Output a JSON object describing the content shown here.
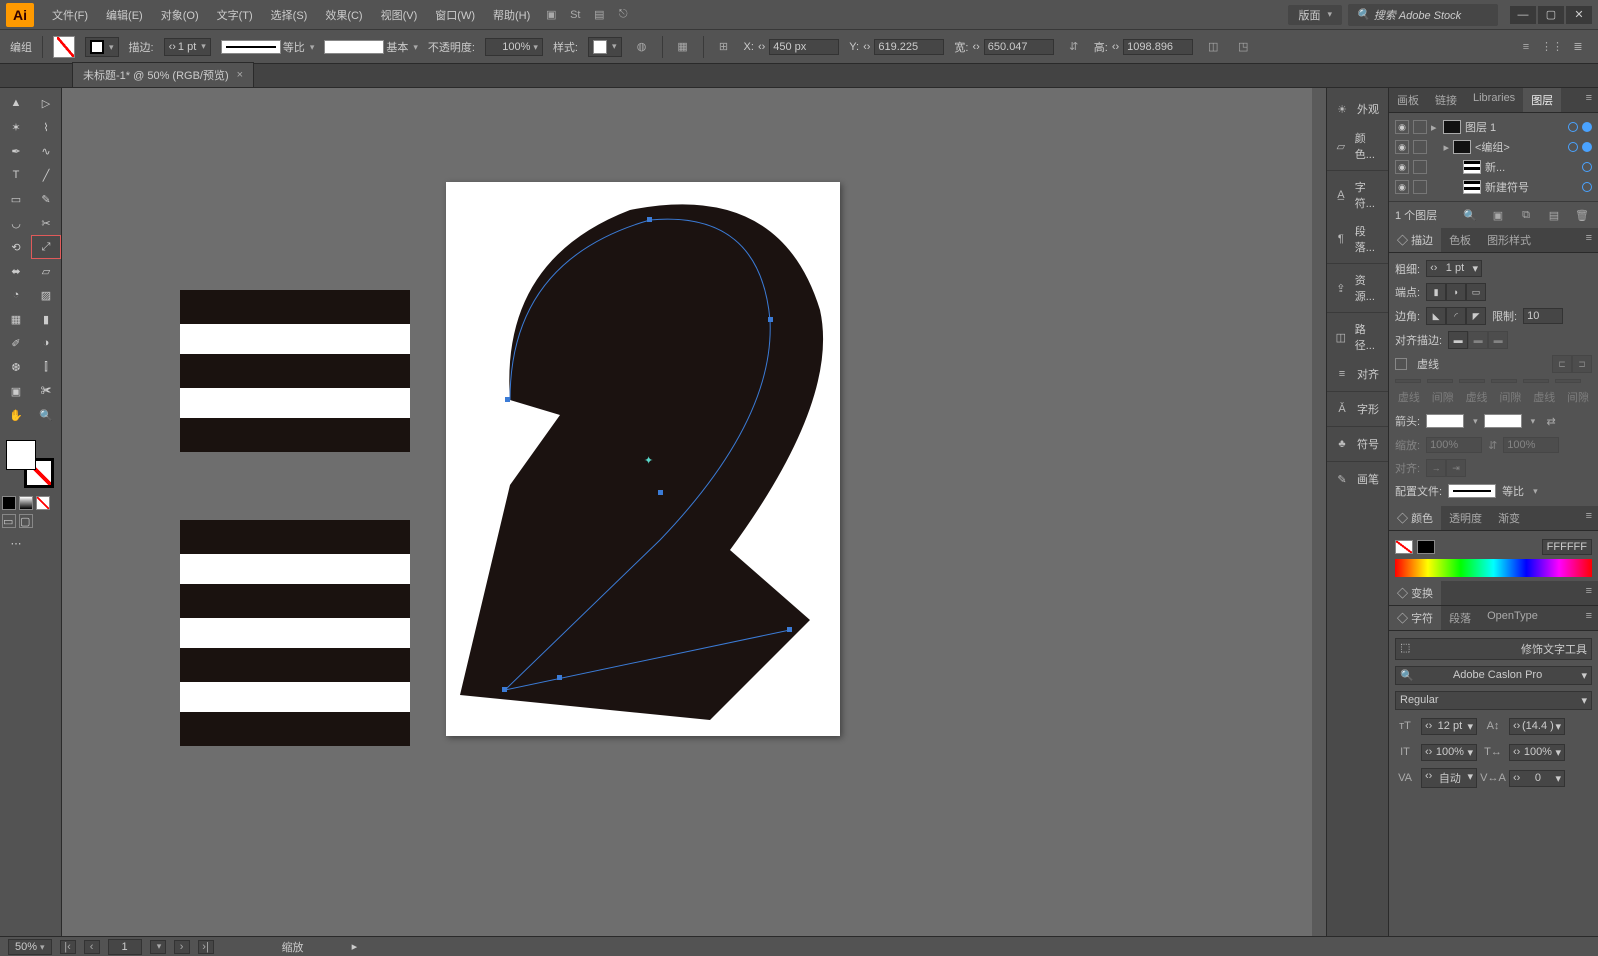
{
  "menu": {
    "items": [
      "文件(F)",
      "编辑(E)",
      "对象(O)",
      "文字(T)",
      "选择(S)",
      "效果(C)",
      "视图(V)",
      "窗口(W)",
      "帮助(H)"
    ],
    "layout_label": "版面",
    "search_placeholder": "搜索 Adobe Stock"
  },
  "control": {
    "mode_label": "编组",
    "stroke_label": "描边:",
    "stroke_weight": "1 pt",
    "profile_label": "等比",
    "brush_label": "基本",
    "opacity_label": "不透明度:",
    "opacity_value": "100%",
    "style_label": "样式:",
    "x_label": "X:",
    "x_value": "450 px",
    "y_label": "Y:",
    "y_value": "619.225",
    "w_label": "宽:",
    "w_value": "650.047",
    "h_label": "高:",
    "h_value": "1098.896"
  },
  "doc_tab": {
    "title": "未标题-1* @ 50% (RGB/预览)"
  },
  "dock": {
    "items": [
      "外观",
      "颜色...",
      "字符...",
      "段落...",
      "资源...",
      "路径...",
      "对齐",
      "字形",
      "符号",
      "画笔"
    ]
  },
  "panels": {
    "layer_tabs": [
      "画板",
      "链接",
      "Libraries",
      "图层"
    ],
    "layers": {
      "rows": [
        {
          "name": "图层 1",
          "indent": 0,
          "thumb": "dark"
        },
        {
          "name": "<编组>",
          "indent": 1,
          "thumb": "dark"
        },
        {
          "name": "新...",
          "indent": 2,
          "thumb": "stripes"
        },
        {
          "name": "新建符号",
          "indent": 2,
          "thumb": "stripes"
        }
      ],
      "footer": "1 个图层"
    },
    "stroke_tabs": [
      "描边",
      "色板",
      "图形样式"
    ],
    "stroke": {
      "weight_label": "粗细:",
      "weight_value": "1 pt",
      "cap_label": "端点:",
      "join_label": "边角:",
      "limit_label": "限制:",
      "limit_value": "10",
      "align_label": "对齐描边:",
      "dash_label": "虚线",
      "dash_cols": [
        "虚线",
        "间隙",
        "虚线",
        "间隙",
        "虚线",
        "间隙"
      ],
      "arrow_label": "箭头:",
      "scale_label": "缩放:",
      "scale_a": "100%",
      "scale_b": "100%",
      "alignarr_label": "对齐:",
      "profile_label": "配置文件:",
      "profile_value": "等比"
    },
    "color_tabs": [
      "颜色",
      "透明度",
      "渐变"
    ],
    "color": {
      "hex": "FFFFFF"
    },
    "transform_title": "变换",
    "char_tabs": [
      "字符",
      "段落",
      "OpenType"
    ],
    "char": {
      "touch_label": "修饰文字工具",
      "font": "Adobe Caslon Pro",
      "weight": "Regular",
      "size": "12 pt",
      "leading": "(14.4 )",
      "hscale": "100%",
      "vscale": "100%",
      "tracking": "自动",
      "kerning": "0"
    }
  },
  "status": {
    "zoom": "50%",
    "page": "1",
    "tool": "缩放"
  }
}
